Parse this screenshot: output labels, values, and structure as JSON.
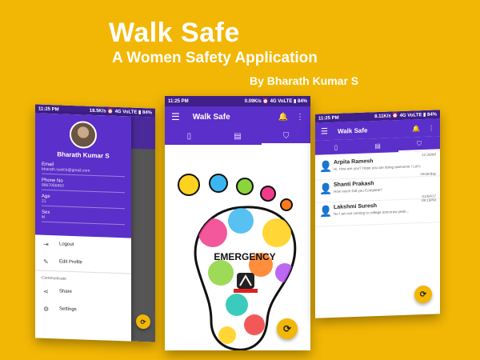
{
  "hero": {
    "title": "Walk Safe",
    "subtitle": "A Women Safety Application",
    "by": "By Bharath Kumar S"
  },
  "left_phone": {
    "status_time": "11:25 PM",
    "status_right": "18.5K/s ⏰ 4G VoLTE ▮ 84%",
    "profile": {
      "name": "Bharath Kumar S",
      "email_label": "Email",
      "email_value": "bharath.sunil.k@gmail.com",
      "phone_label": "Phone No",
      "phone_value": "8867056863",
      "age_label": "Age",
      "age_value": "21",
      "sex_label": "Sex",
      "sex_value": "M"
    },
    "menu": {
      "logout": "Logout",
      "edit_profile": "Edit Profile",
      "section": "Communicate",
      "share": "Share",
      "settings": "Settings"
    }
  },
  "center_phone": {
    "status_time": "11:25 PM",
    "status_right": "0.09K/s ⏰ 4G VoLTE ▮ 84%",
    "app_title": "Walk Safe",
    "emergency_label": "EMERGENCY"
  },
  "right_phone": {
    "status_time": "11:25 PM",
    "status_right": "8.11K/s ⏰ 4G VoLTE ▮ 84%",
    "app_title": "Walk Safe",
    "chats": [
      {
        "name": "Arpita Ramesh",
        "message": "Hi, How are you? Hope you are doing awesome ! Let's",
        "time": "12:30AM"
      },
      {
        "name": "Shanti Prakash",
        "message": "How much Did you Complete?",
        "time": "Yesterday"
      },
      {
        "name": "Lakshmi Suresh",
        "message": "No I am not coming to college tomorrow yeah...",
        "time": "01/04/17\n09:10PM"
      }
    ]
  },
  "colors": {
    "background": "#f2b705",
    "primary": "#5b2fc9",
    "status_bar": "#3f1f8a",
    "accent": "#f2b705"
  }
}
